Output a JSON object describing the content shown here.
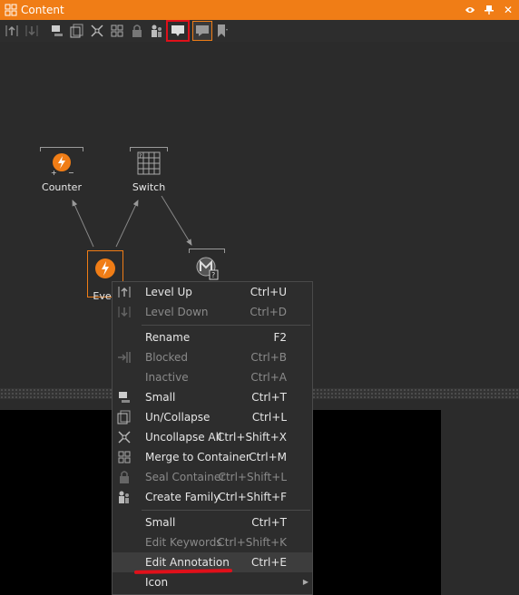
{
  "window": {
    "title": "Content"
  },
  "nodes": {
    "counter": "Counter",
    "switch": "Switch",
    "event": "Even"
  },
  "menu": {
    "items": [
      {
        "label": "Level Up",
        "shortcut": "Ctrl+U",
        "disabled": false
      },
      {
        "label": "Level Down",
        "shortcut": "Ctrl+D",
        "disabled": true
      },
      {
        "label": "Rename",
        "shortcut": "F2",
        "disabled": false
      },
      {
        "label": "Blocked",
        "shortcut": "Ctrl+B",
        "disabled": true
      },
      {
        "label": "Inactive",
        "shortcut": "Ctrl+A",
        "disabled": true
      },
      {
        "label": "Small",
        "shortcut": "Ctrl+T",
        "disabled": false
      },
      {
        "label": "Un/Collapse",
        "shortcut": "Ctrl+L",
        "disabled": false
      },
      {
        "label": "Uncollapse All",
        "shortcut": "Ctrl+Shift+X",
        "disabled": false
      },
      {
        "label": "Merge to Container",
        "shortcut": "Ctrl+M",
        "disabled": false
      },
      {
        "label": "Seal Container",
        "shortcut": "Ctrl+Shift+L",
        "disabled": true
      },
      {
        "label": "Create Family",
        "shortcut": "Ctrl+Shift+F",
        "disabled": false
      },
      {
        "label": "Small",
        "shortcut": "Ctrl+T",
        "disabled": false
      },
      {
        "label": "Edit Keywords",
        "shortcut": "Ctrl+Shift+K",
        "disabled": true
      },
      {
        "label": "Edit Annotation",
        "shortcut": "Ctrl+E",
        "disabled": false
      },
      {
        "label": "Icon",
        "shortcut": "",
        "disabled": false
      }
    ]
  },
  "colors": {
    "accent": "#f07d16",
    "highlight": "#e0101a",
    "background": "#2b2b2b"
  }
}
